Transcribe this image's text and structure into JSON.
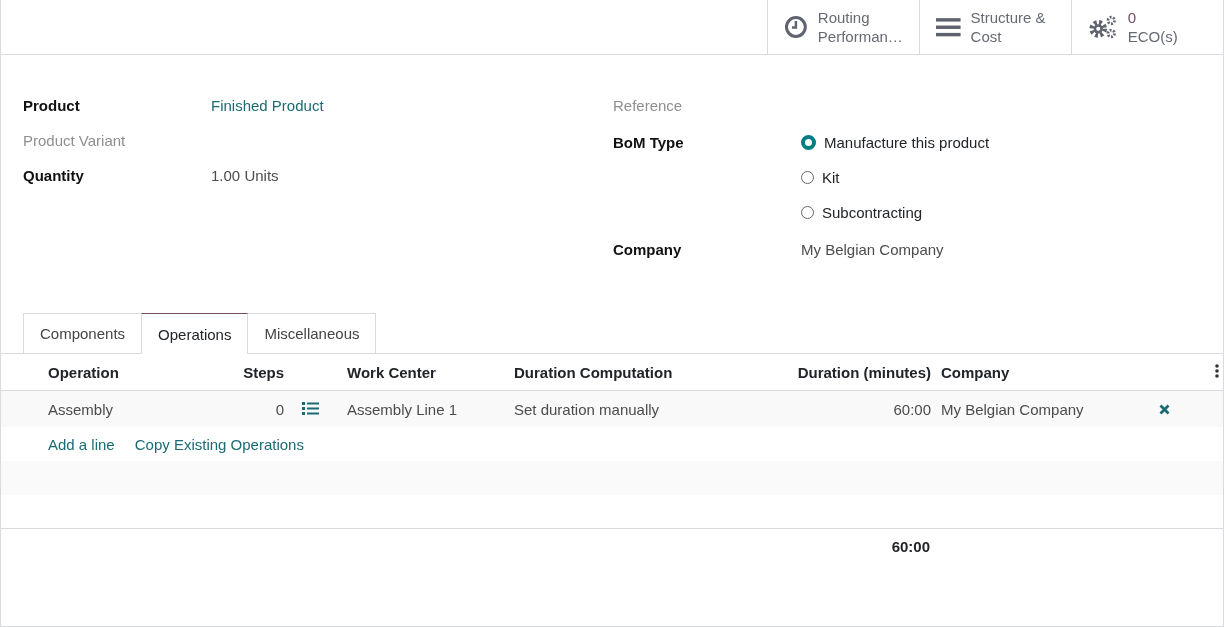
{
  "stat_buttons": [
    {
      "kind": "clock",
      "label": "Routing Performan…"
    },
    {
      "kind": "bars",
      "label": "Structure & Cost"
    },
    {
      "kind": "gears",
      "count": "0",
      "label": "ECO(s)"
    }
  ],
  "left_fields": [
    {
      "label": "Product",
      "muted": false,
      "value": "Finished Product",
      "kind": "link"
    },
    {
      "label": "Product Variant",
      "muted": true
    },
    {
      "label": "Quantity",
      "muted": false,
      "value": "1.00",
      "unit": "Units",
      "kind": "quantity"
    }
  ],
  "right_fields": [
    {
      "label": "Reference",
      "muted": true,
      "kind": "text"
    },
    {
      "label": "BoM Type",
      "muted": false,
      "kind": "radio",
      "options": [
        {
          "label": "Manufacture this product",
          "selected": true
        },
        {
          "label": "Kit",
          "selected": false
        },
        {
          "label": "Subcontracting",
          "selected": false
        }
      ]
    },
    {
      "label": "Company",
      "muted": false,
      "kind": "text",
      "value": "My Belgian Company"
    }
  ],
  "tabs": [
    {
      "label": "Components",
      "selected": false
    },
    {
      "label": "Operations",
      "selected": true
    },
    {
      "label": "Miscellaneous",
      "selected": false
    }
  ],
  "table": {
    "columns": [
      "Operation",
      "Steps",
      "Work Center",
      "Duration Computation",
      "Duration (minutes)",
      "Company"
    ],
    "rows": [
      {
        "cells": [
          "Assembly",
          "0",
          "Assembly Line 1",
          "Set duration manually",
          "60:00",
          "My Belgian Company"
        ]
      }
    ],
    "actions": [
      "Add a line",
      "Copy Existing Operations"
    ],
    "total": "60:00"
  }
}
